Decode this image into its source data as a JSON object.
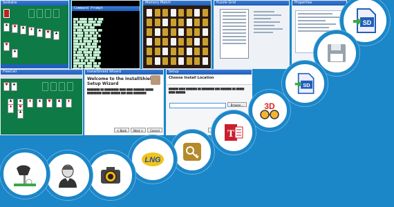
{
  "screens": {
    "solitaire_top": {
      "title": "Solitaire"
    },
    "console": {
      "title": "Command Prompt"
    },
    "card_grid": {
      "title": "Memory Match"
    },
    "number_grid": {
      "title": "Puzzle Grid"
    },
    "props_window": {
      "title": "Properties"
    },
    "freecell": {
      "title": "FreeCell"
    },
    "wizard": {
      "title": "InstallShield Wizard",
      "heading": "Welcome to the InstallShield Setup Wizard",
      "back_label": "< Back",
      "next_label": "Next >",
      "cancel_label": "Cancel"
    },
    "location": {
      "title": "Setup",
      "heading": "Choose Install Location",
      "browse_label": "Browse...",
      "install_label": "Install",
      "cancel_label": "Cancel"
    }
  },
  "icons": [
    "sd-card-icon",
    "floppy-disk-icon",
    "sd-card-icon",
    "3d-glasses-icon",
    "office-t-icon",
    "key-lock-icon",
    "lng-logo-icon",
    "camera-icon",
    "portrait-icon",
    "golf-club-icon"
  ],
  "colors": {
    "background": "#1b86c8",
    "felt": "#0e7a45",
    "sd_green": "#3aa845",
    "sd_blue": "#1f5fb8"
  }
}
